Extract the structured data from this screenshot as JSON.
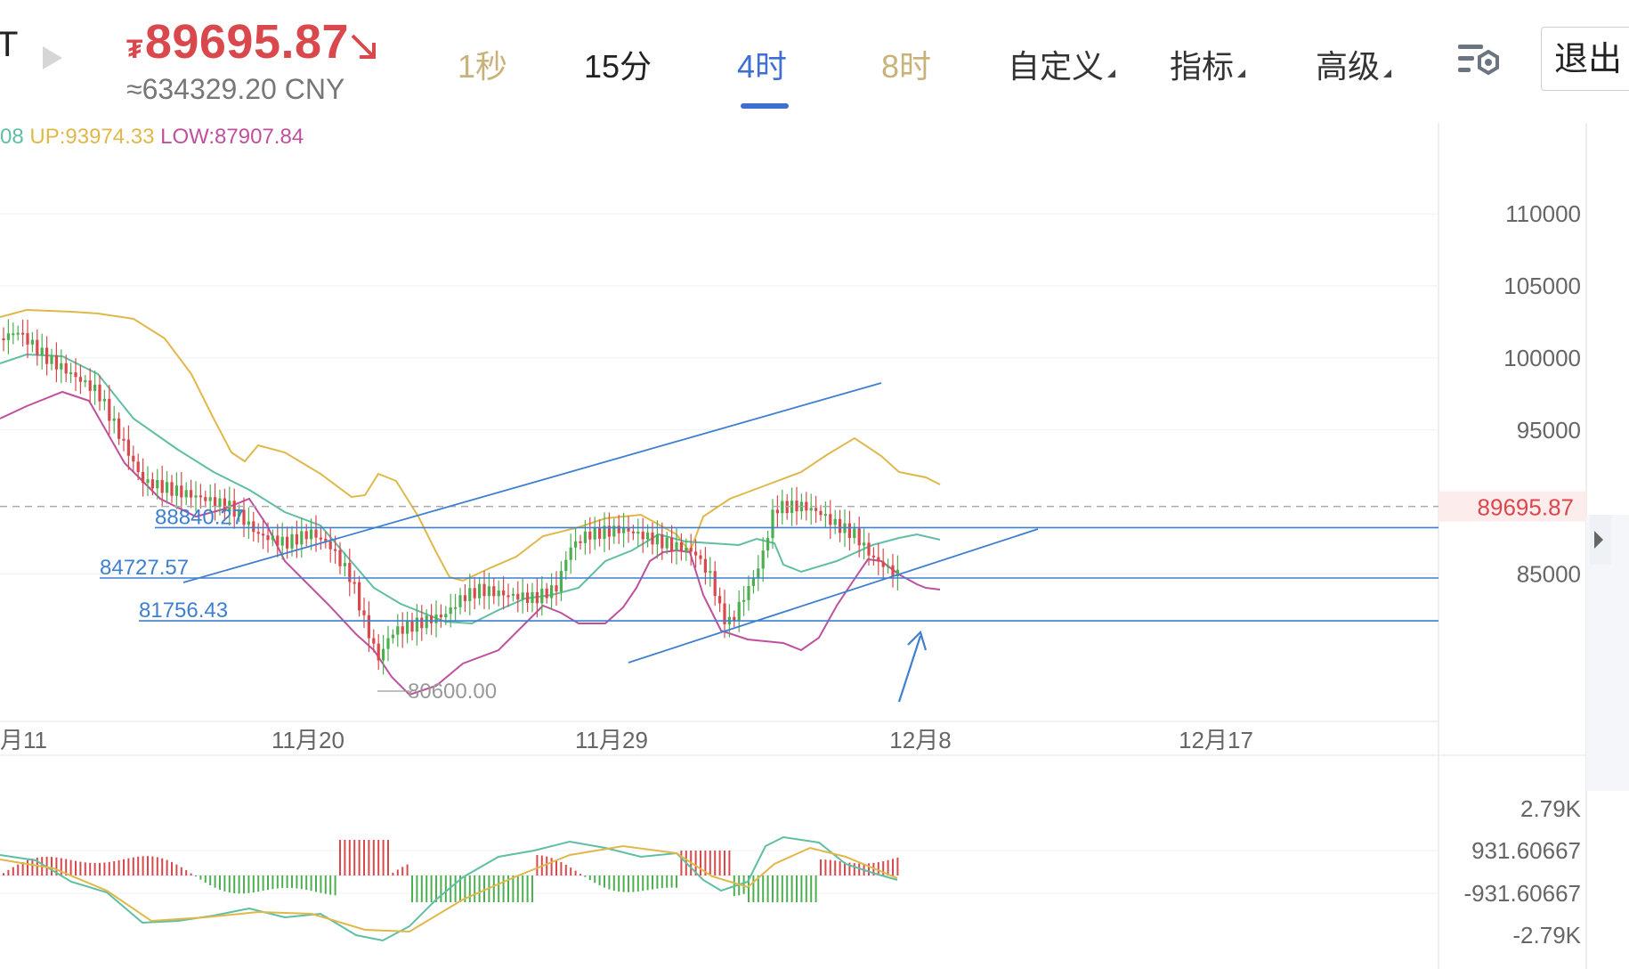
{
  "header": {
    "pair_fragment": "T",
    "price_symbol": "₮",
    "price": "89695.87",
    "price_cny": "≈634329.20 CNY",
    "price_color": "#d9484c"
  },
  "tabs": [
    {
      "label": "1秒",
      "color": "#c9b27a"
    },
    {
      "label": "15分",
      "color": "#222222"
    },
    {
      "label": "4时",
      "color": "#3f6fd0",
      "active": true
    },
    {
      "label": "8时",
      "color": "#c9b27a"
    },
    {
      "label": "自定义",
      "color": "#333333",
      "dropdown": true
    },
    {
      "label": "指标",
      "color": "#333333",
      "dropdown": true
    },
    {
      "label": "高级",
      "color": "#333333",
      "dropdown": true
    }
  ],
  "toolbar": {
    "exit_label": "退出",
    "settings_icon": "chart-settings-icon"
  },
  "indicator_legend": {
    "mid": "08",
    "up": "UP:93974.33",
    "low": "LOW:87907.84",
    "mid_color": "#5fbfa4",
    "up_color": "#e0b84a",
    "low_color": "#c0509e"
  },
  "chart_data": {
    "type": "candlestick",
    "price_axis": {
      "ticks": [
        "110000",
        "105000",
        "100000",
        "95000",
        "85000"
      ],
      "ylim": [
        78500,
        120500
      ]
    },
    "current_price_tag": "89695.87",
    "x_axis": {
      "ticks": [
        "月11",
        "11月20",
        "11月29",
        "12月8",
        "12月17"
      ]
    },
    "horizontal_levels": [
      {
        "label": "88840.27",
        "value": 88840.27
      },
      {
        "label": "84727.57",
        "value": 84727.57
      },
      {
        "label": "81756.43",
        "value": 81756.43
      }
    ],
    "low_marker": "80600.00",
    "macd_axis": {
      "ticks": [
        "2.79K",
        "931.60667",
        "-931.60667",
        "-2.79K"
      ]
    },
    "colors": {
      "up": "#4caf50",
      "down": "#d9484c",
      "trendline": "#3f7fd0",
      "bb_mid": "#5fbfa4",
      "bb_up": "#e0b84a",
      "bb_low": "#c0509e"
    }
  }
}
